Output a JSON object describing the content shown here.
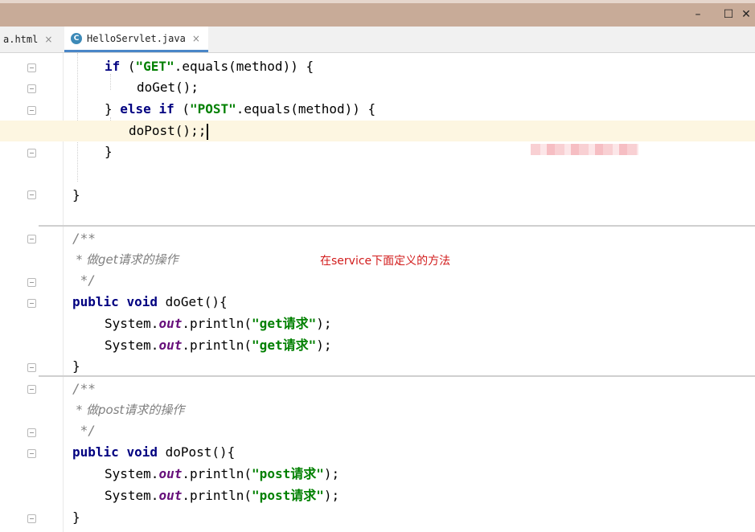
{
  "window": {
    "minimize_icon": "minimize-icon",
    "maximize_icon": "maximize-icon",
    "close_icon": "close-icon",
    "minimize_glyph": "–",
    "maximize_glyph": "☐",
    "close_glyph": "✕"
  },
  "tabs": [
    {
      "label": "a.html",
      "close": "×"
    },
    {
      "label": "HelloServlet.java",
      "close": "×",
      "icon_letter": "C"
    }
  ],
  "code": {
    "l1": {
      "kw": "if",
      "p1": " (",
      "s": "\"GET\"",
      "p2": ".equals(method)) {"
    },
    "l2": {
      "text": "doGet();"
    },
    "l3": {
      "p0": "} ",
      "kw1": "else",
      "sp": " ",
      "kw2": "if",
      "p1": " (",
      "s": "\"POST\"",
      "p2": ".equals(method)) {"
    },
    "l4": {
      "text": "doPost();;"
    },
    "l5": {
      "text": "}"
    },
    "l6": {
      "text": "}"
    },
    "c1a": "/**",
    "c1b": " * 做get请求的操作",
    "c1c": " */",
    "m1": {
      "kw1": "public",
      "kw2": "void",
      "sig": " doGet(){"
    },
    "p1": {
      "a": "System.",
      "f": "out",
      "b": ".println(",
      "s": "\"get请求\"",
      "c": ");"
    },
    "p2": {
      "a": "System.",
      "f": "out",
      "b": ".println(",
      "s": "\"get请求\"",
      "c": ");"
    },
    "e1": "}",
    "c2a": "/**",
    "c2b": " * 做post请求的操作",
    "c2c": " */",
    "m2": {
      "kw1": "public",
      "kw2": "void",
      "sig": " doPost(){"
    },
    "p3": {
      "a": "System.",
      "f": "out",
      "b": ".println(",
      "s": "\"post请求\"",
      "c": ");"
    },
    "p4": {
      "a": "System.",
      "f": "out",
      "b": ".println(",
      "s": "\"post请求\"",
      "c": ");"
    },
    "e2": "}"
  },
  "annotation": "在service下面定义的方法",
  "colors": {
    "keyword": "#000080",
    "string": "#008000",
    "comment": "#808080",
    "annotation": "#d21c1c",
    "titlebar": "#c8ab98"
  }
}
